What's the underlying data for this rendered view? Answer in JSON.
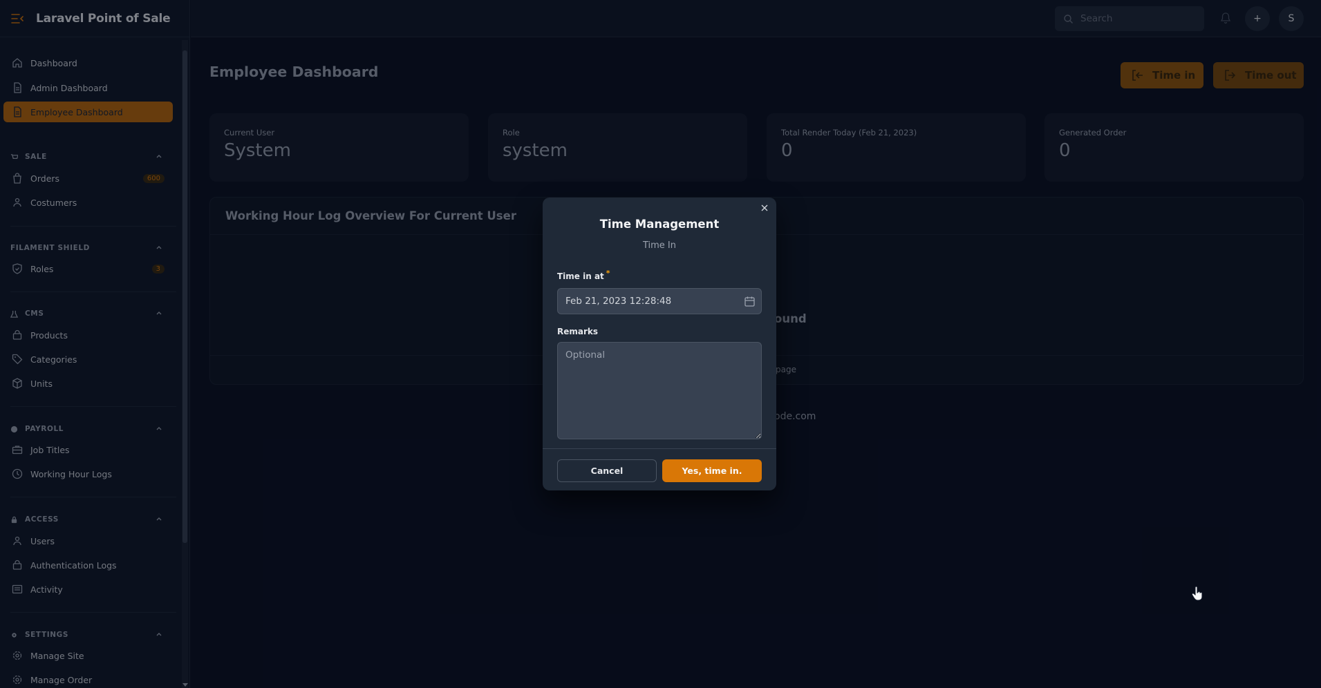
{
  "app": {
    "brand": "Laravel Point of Sale"
  },
  "topbar": {
    "search_placeholder": "Search",
    "avatar_initial": "S",
    "add_label": "+"
  },
  "sidebar": {
    "items": {
      "dashboard": "Dashboard",
      "admin_dashboard": "Admin Dashboard",
      "employee_dashboard": "Employee Dashboard",
      "orders": "Orders",
      "orders_badge": "600",
      "costumers": "Costumers",
      "roles": "Roles",
      "roles_badge": "3",
      "products": "Products",
      "categories": "Categories",
      "units": "Units",
      "job_titles": "Job Titles",
      "working_hour_logs": "Working Hour Logs",
      "users": "Users",
      "authentication_logs": "Authentication Logs",
      "activity": "Activity",
      "manage_site": "Manage Site",
      "manage_order": "Manage Order"
    },
    "groups": {
      "sale": "SALE",
      "filament_shield": "FILAMENT SHIELD",
      "cms": "CMS",
      "payroll": "PAYROLL",
      "access": "ACCESS",
      "settings": "SETTINGS"
    }
  },
  "main": {
    "title": "Employee Dashboard",
    "time_in_label": "Time in",
    "time_out_label": "Time out",
    "stats": [
      {
        "label": "Current User",
        "value": "System"
      },
      {
        "label": "Role",
        "value": "system"
      },
      {
        "label": "Total Render Today (Feb 21, 2023)",
        "value": "0"
      },
      {
        "label": "Generated Order",
        "value": "0"
      }
    ],
    "table_title": "Working Hour Log Overview For Current User",
    "peek_found": "ound",
    "peek_page": "page",
    "peek_footer": "ode.com"
  },
  "modal": {
    "title": "Time Management",
    "subtitle": "Time In",
    "time_in_label": "Time in at",
    "required_mark": "*",
    "time_in_value": "Feb 21, 2023 12:28:48",
    "remarks_label": "Remarks",
    "remarks_placeholder": "Optional",
    "cancel_label": "Cancel",
    "confirm_label": "Yes, time in."
  },
  "colors": {
    "accent": "#d97706",
    "background": "#0b1120",
    "panel": "#1f2937"
  }
}
